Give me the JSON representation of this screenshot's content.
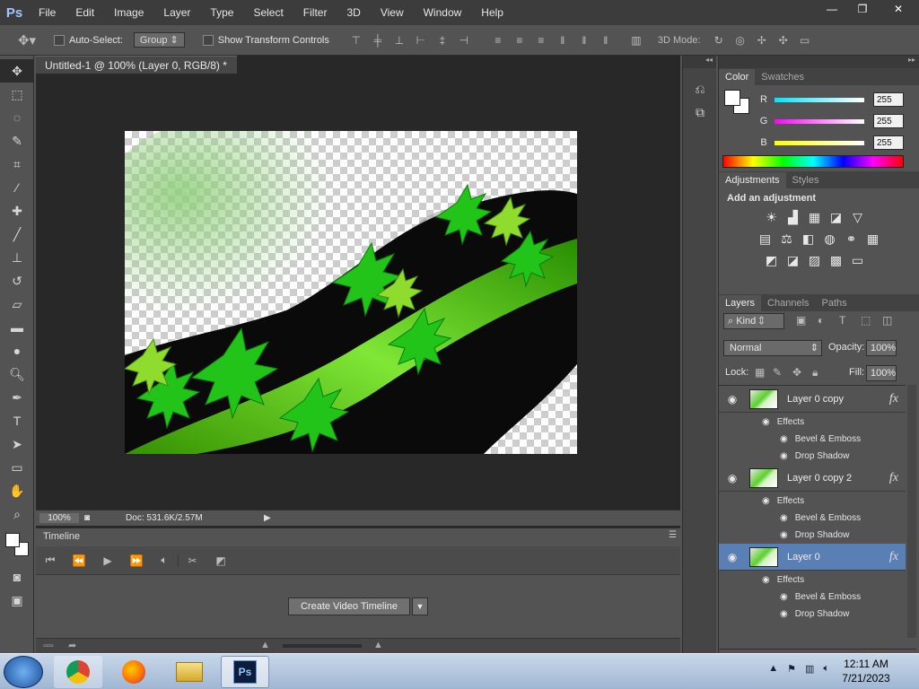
{
  "app": {
    "logo": "Ps"
  },
  "menu": [
    "File",
    "Edit",
    "Image",
    "Layer",
    "Type",
    "Select",
    "Filter",
    "3D",
    "View",
    "Window",
    "Help"
  ],
  "window_controls": {
    "minimize": "—",
    "restore": "❐",
    "close": "✕"
  },
  "options_bar": {
    "auto_select_label": "Auto-Select:",
    "auto_select_value": "Group",
    "show_transform_label": "Show Transform Controls",
    "mode_3d_label": "3D Mode:"
  },
  "document": {
    "tab_title": "Untitled-1 @ 100% (Layer 0, RGB/8) *",
    "zoom": "100%",
    "doc_info": "Doc: 531.6K/2.57M"
  },
  "timeline": {
    "tab": "Timeline",
    "create_button": "Create Video Timeline"
  },
  "color_panel": {
    "tabs": [
      "Color",
      "Swatches"
    ],
    "channels": [
      {
        "label": "R",
        "value": "255",
        "color": "#00e5ff"
      },
      {
        "label": "G",
        "value": "255",
        "color": "#ff00ff"
      },
      {
        "label": "B",
        "value": "255",
        "color": "#ffff00"
      }
    ]
  },
  "adjustments_panel": {
    "tabs": [
      "Adjustments",
      "Styles"
    ],
    "heading": "Add an adjustment"
  },
  "layers_panel": {
    "tabs": [
      "Layers",
      "Channels",
      "Paths"
    ],
    "filter_kind": "Kind",
    "blend_mode": "Normal",
    "opacity_label": "Opacity:",
    "opacity_value": "100%",
    "lock_label": "Lock:",
    "fill_label": "Fill:",
    "fill_value": "100%",
    "layers": [
      {
        "name": "Layer 0 copy",
        "effects_label": "Effects",
        "effects": [
          "Bevel & Emboss",
          "Drop Shadow"
        ],
        "selected": false
      },
      {
        "name": "Layer 0 copy 2",
        "effects_label": "Effects",
        "effects": [
          "Bevel & Emboss",
          "Drop Shadow"
        ],
        "selected": false
      },
      {
        "name": "Layer 0",
        "effects_label": "Effects",
        "effects": [
          "Bevel & Emboss",
          "Drop Shadow"
        ],
        "selected": true
      }
    ],
    "fx_symbol": "fx"
  },
  "taskbar": {
    "time": "12:11 AM",
    "date": "7/21/2023"
  },
  "icons": [
    "move-tool-icon",
    "marquee-icon",
    "lasso-icon",
    "quick-select-icon",
    "crop-icon",
    "eyedropper-icon",
    "healing-icon",
    "brush-icon",
    "stamp-icon",
    "history-brush-icon",
    "eraser-icon",
    "gradient-icon",
    "blur-icon",
    "dodge-icon",
    "pen-icon",
    "type-icon",
    "path-select-icon",
    "shape-icon",
    "hand-icon",
    "zoom-icon"
  ],
  "accent": "#5a7fb5"
}
